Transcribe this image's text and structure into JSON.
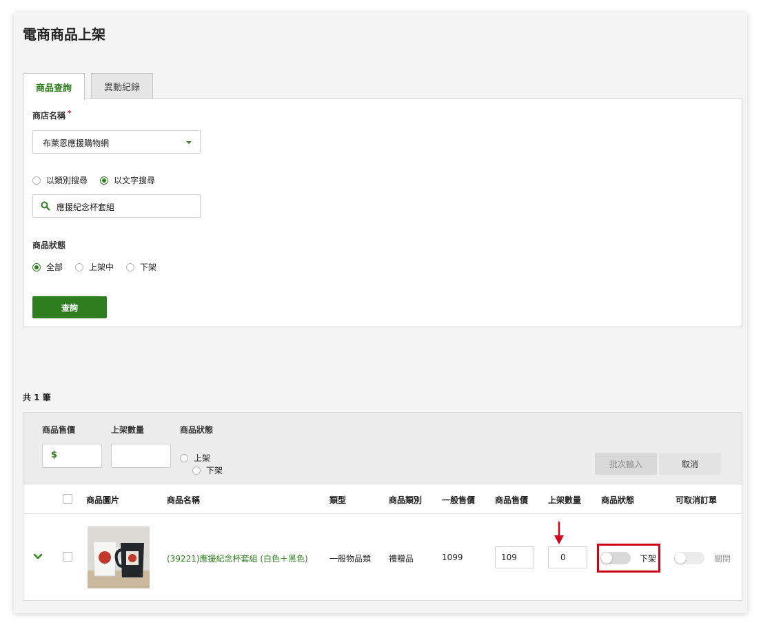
{
  "page": {
    "title": "電商商品上架"
  },
  "tabs": [
    {
      "label": "商品查詢",
      "active": true
    },
    {
      "label": "異動紀錄",
      "active": false
    }
  ],
  "form": {
    "store_label": "商店名稱",
    "required_mark": "*",
    "store_value": "布萊恩應援購物網",
    "search_mode_options": [
      "以類別搜尋",
      "以文字搜尋"
    ],
    "search_mode_selected": "以文字搜尋",
    "search_text": "應援紀念杯套組",
    "status_label": "商品狀態",
    "status_options": [
      "全部",
      "上架中",
      "下架"
    ],
    "status_selected": "全部",
    "query_button": "查詢"
  },
  "results": {
    "total_text": "共 1 筆"
  },
  "batch": {
    "price_label": "商品售價",
    "qty_label": "上架數量",
    "status_label": "商品狀態",
    "currency_symbol": "$",
    "status_options": [
      "上架",
      "下架"
    ],
    "batch_button": "批次輸入",
    "cancel_button": "取消"
  },
  "table": {
    "columns": [
      "商品圖片",
      "商品名稱",
      "類型",
      "商品類別",
      "一般售價",
      "商品售價",
      "上架數量",
      "商品狀態",
      "可取消訂單"
    ],
    "rows": [
      {
        "name": "(39221)應援紀念杯套組 (白色＋黑色)",
        "type": "一般物品類",
        "category": "禮贈品",
        "regular_price": "1099",
        "sale_price": "109",
        "quantity": "0",
        "status": "下架",
        "status_on": false,
        "cancelable": "關閉",
        "cancelable_on": false
      }
    ]
  },
  "colors": {
    "accent": "#2e7d1e",
    "highlight": "#d0021b"
  }
}
